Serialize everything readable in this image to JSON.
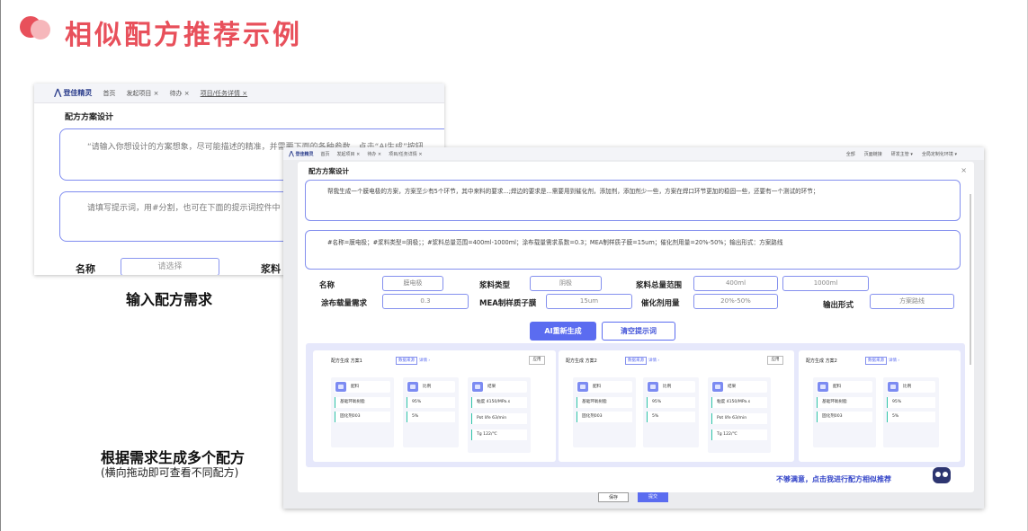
{
  "slide": {
    "title": "相似配方推荐示例"
  },
  "captions": {
    "input_caption": "输入配方需求",
    "generate_caption": "根据需求生成多个配方",
    "generate_sub": "(横向拖动即可查看不同配方)"
  },
  "shotA": {
    "brand": "登佳精灵",
    "tabs": [
      "首页",
      "发起项目 ×",
      "待办 ×",
      "项目/任务详情 ×"
    ],
    "panel_title": "配方方案设计",
    "scheme_placeholder": "“请输入你想设计的方案想象，尽可能描述的精准，并需要下面的各种参数，点击“AI生成”按钮",
    "prompt_placeholder": "请填写提示词，用#分割，也可在下面的提示词控件中",
    "name_label": "名称",
    "select_placeholder": "请选择",
    "slurry_label": "浆料"
  },
  "shotB": {
    "brand": "登佳精灵",
    "tabs": [
      "首页",
      "发起项目 ×",
      "待办 ×",
      "项目/任务详情 ×"
    ],
    "top_right": [
      "全部",
      "页面链接",
      "研发主管 ▾",
      "全局定制化环境 ▾"
    ],
    "modal_title": "配方方案设计",
    "close": "×",
    "scheme_text": "帮我生成一个膜电极的方案，方案至少有5个环节，其中来料的要求...;焊边的要求是...需要用到催化剂，添加剂，添加剂少一些，方案在焊口环节更加的稳固一些，还要有一个测试的环节；",
    "prompt_text": "#名称=膜电极；#浆料类型=阴极；；#浆料总量范围=400ml-1000ml；涂布载量需求系数=0.3；MEA制样质子膜=15um；催化剂用量=20%-50%；输出形式：方案路线",
    "fields": {
      "name_label": "名称",
      "name_value": "膜电极",
      "slurry_label": "浆料类型",
      "slurry_value": "阴极",
      "total_label": "浆料总量范围",
      "total_min": "400ml",
      "total_max": "1000ml",
      "coat_label": "涂布载量需求",
      "coat_value": "0.3",
      "mea_label": "MEA制样质子膜",
      "mea_value": "15um",
      "cat_label": "催化剂用量",
      "cat_value": "20%-50%",
      "output_label": "输出形式",
      "output_value": "方案路线"
    },
    "btn_ai": "AI重新生成",
    "btn_clear": "清空提示词",
    "cards": [
      {
        "title": "配方生成 方案1",
        "tag": "数据来源",
        "link": "详情 ›",
        "apply": "应用",
        "c1_head": "配料",
        "c1": [
          "基础环氧树脂",
          "固化剂003"
        ],
        "c2_head": "比例",
        "c2": [
          "95%",
          "5%"
        ],
        "c3_head": "结果",
        "c3": [
          "粘度 4150/MPa.s",
          "Pot life  63/min",
          "Tg  122/℃"
        ]
      },
      {
        "title": "配方生成 方案2",
        "tag": "数据来源",
        "link": "详情 ›",
        "apply": "应用",
        "c1_head": "配料",
        "c1": [
          "基础环氧树脂",
          "固化剂003"
        ],
        "c2_head": "比例",
        "c2": [
          "95%",
          "5%"
        ],
        "c3_head": "结果",
        "c3": [
          "粘度 4150/MPa.s",
          "Pot life  63/min",
          "Tg  122/℃"
        ]
      },
      {
        "title": "配方生成 方案2",
        "tag": "数据来源",
        "link": "详情 ›",
        "c1_head": "配料",
        "c1": [
          "基础环氧树脂",
          "固化剂003"
        ],
        "c2_head": "比例",
        "c2": [
          "95%",
          "5%"
        ]
      }
    ],
    "footer_link": "不够满意，点击我进行配方相似推荐",
    "bottom_buttons": [
      "保存",
      "提交"
    ]
  }
}
